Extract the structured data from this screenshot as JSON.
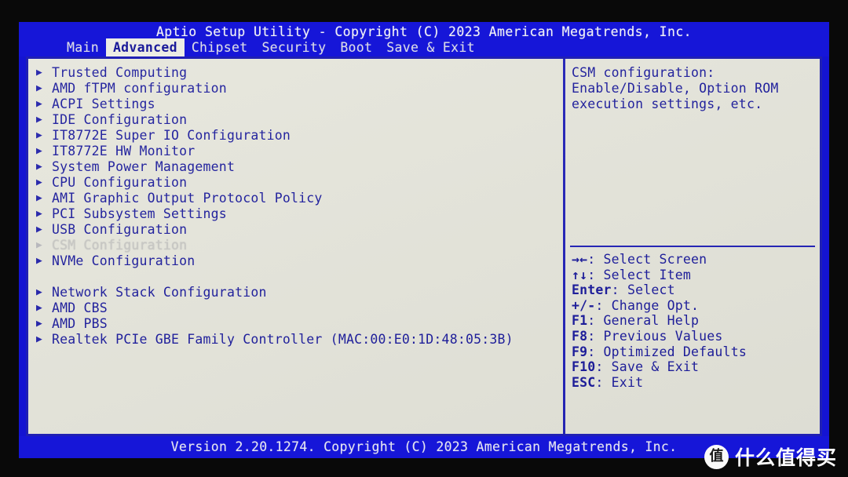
{
  "header": {
    "title": "Aptio Setup Utility - Copyright (C) 2023 American Megatrends, Inc.",
    "tabs": [
      {
        "label": "Main",
        "active": false
      },
      {
        "label": "Advanced",
        "active": true
      },
      {
        "label": "Chipset",
        "active": false
      },
      {
        "label": "Security",
        "active": false
      },
      {
        "label": "Boot",
        "active": false
      },
      {
        "label": "Save & Exit",
        "active": false
      }
    ]
  },
  "menu": {
    "caret": "▶",
    "items": [
      {
        "label": "Trusted Computing",
        "selected": false,
        "gap_before": false
      },
      {
        "label": "AMD fTPM configuration",
        "selected": false,
        "gap_before": false
      },
      {
        "label": "ACPI Settings",
        "selected": false,
        "gap_before": false
      },
      {
        "label": "IDE Configuration",
        "selected": false,
        "gap_before": false
      },
      {
        "label": "IT8772E Super IO Configuration",
        "selected": false,
        "gap_before": false
      },
      {
        "label": "IT8772E HW Monitor",
        "selected": false,
        "gap_before": false
      },
      {
        "label": "System Power Management",
        "selected": false,
        "gap_before": false
      },
      {
        "label": "CPU Configuration",
        "selected": false,
        "gap_before": false
      },
      {
        "label": "AMI Graphic Output Protocol Policy",
        "selected": false,
        "gap_before": false
      },
      {
        "label": "PCI Subsystem Settings",
        "selected": false,
        "gap_before": false
      },
      {
        "label": "USB Configuration",
        "selected": false,
        "gap_before": false
      },
      {
        "label": "CSM Configuration",
        "selected": true,
        "gap_before": false
      },
      {
        "label": "NVMe Configuration",
        "selected": false,
        "gap_before": false
      },
      {
        "label": "Network Stack Configuration",
        "selected": false,
        "gap_before": true
      },
      {
        "label": "AMD CBS",
        "selected": false,
        "gap_before": false
      },
      {
        "label": "AMD PBS",
        "selected": false,
        "gap_before": false
      },
      {
        "label": "Realtek PCIe GBE Family Controller (MAC:00:E0:1D:48:05:3B)",
        "selected": false,
        "gap_before": false
      }
    ]
  },
  "help": {
    "lines": [
      "CSM configuration:",
      "Enable/Disable, Option ROM",
      "execution settings, etc."
    ]
  },
  "legend": {
    "lines": [
      {
        "keys": "→←",
        "text": ": Select Screen"
      },
      {
        "keys": "↑↓",
        "text": ": Select Item"
      },
      {
        "keys": "Enter",
        "text": ": Select"
      },
      {
        "keys": "+/-",
        "text": ": Change Opt."
      },
      {
        "keys": "F1",
        "text": ": General Help"
      },
      {
        "keys": "F8",
        "text": ": Previous Values"
      },
      {
        "keys": "F9",
        "text": ": Optimized Defaults"
      },
      {
        "keys": "F10",
        "text": ": Save & Exit"
      },
      {
        "keys": "ESC",
        "text": ": Exit"
      }
    ]
  },
  "footer": {
    "text": "Version 2.20.1274. Copyright (C) 2023 American Megatrends, Inc."
  },
  "watermark": {
    "badge": "值",
    "text": "什么值得买"
  },
  "colors": {
    "header_blue": "#1616d8",
    "panel_beige": "#e6e6dc",
    "text_blue": "#1b1b9c",
    "border_blue": "#2323b8",
    "selected_text": "#c9c9c4",
    "bezel_black": "#090909"
  }
}
